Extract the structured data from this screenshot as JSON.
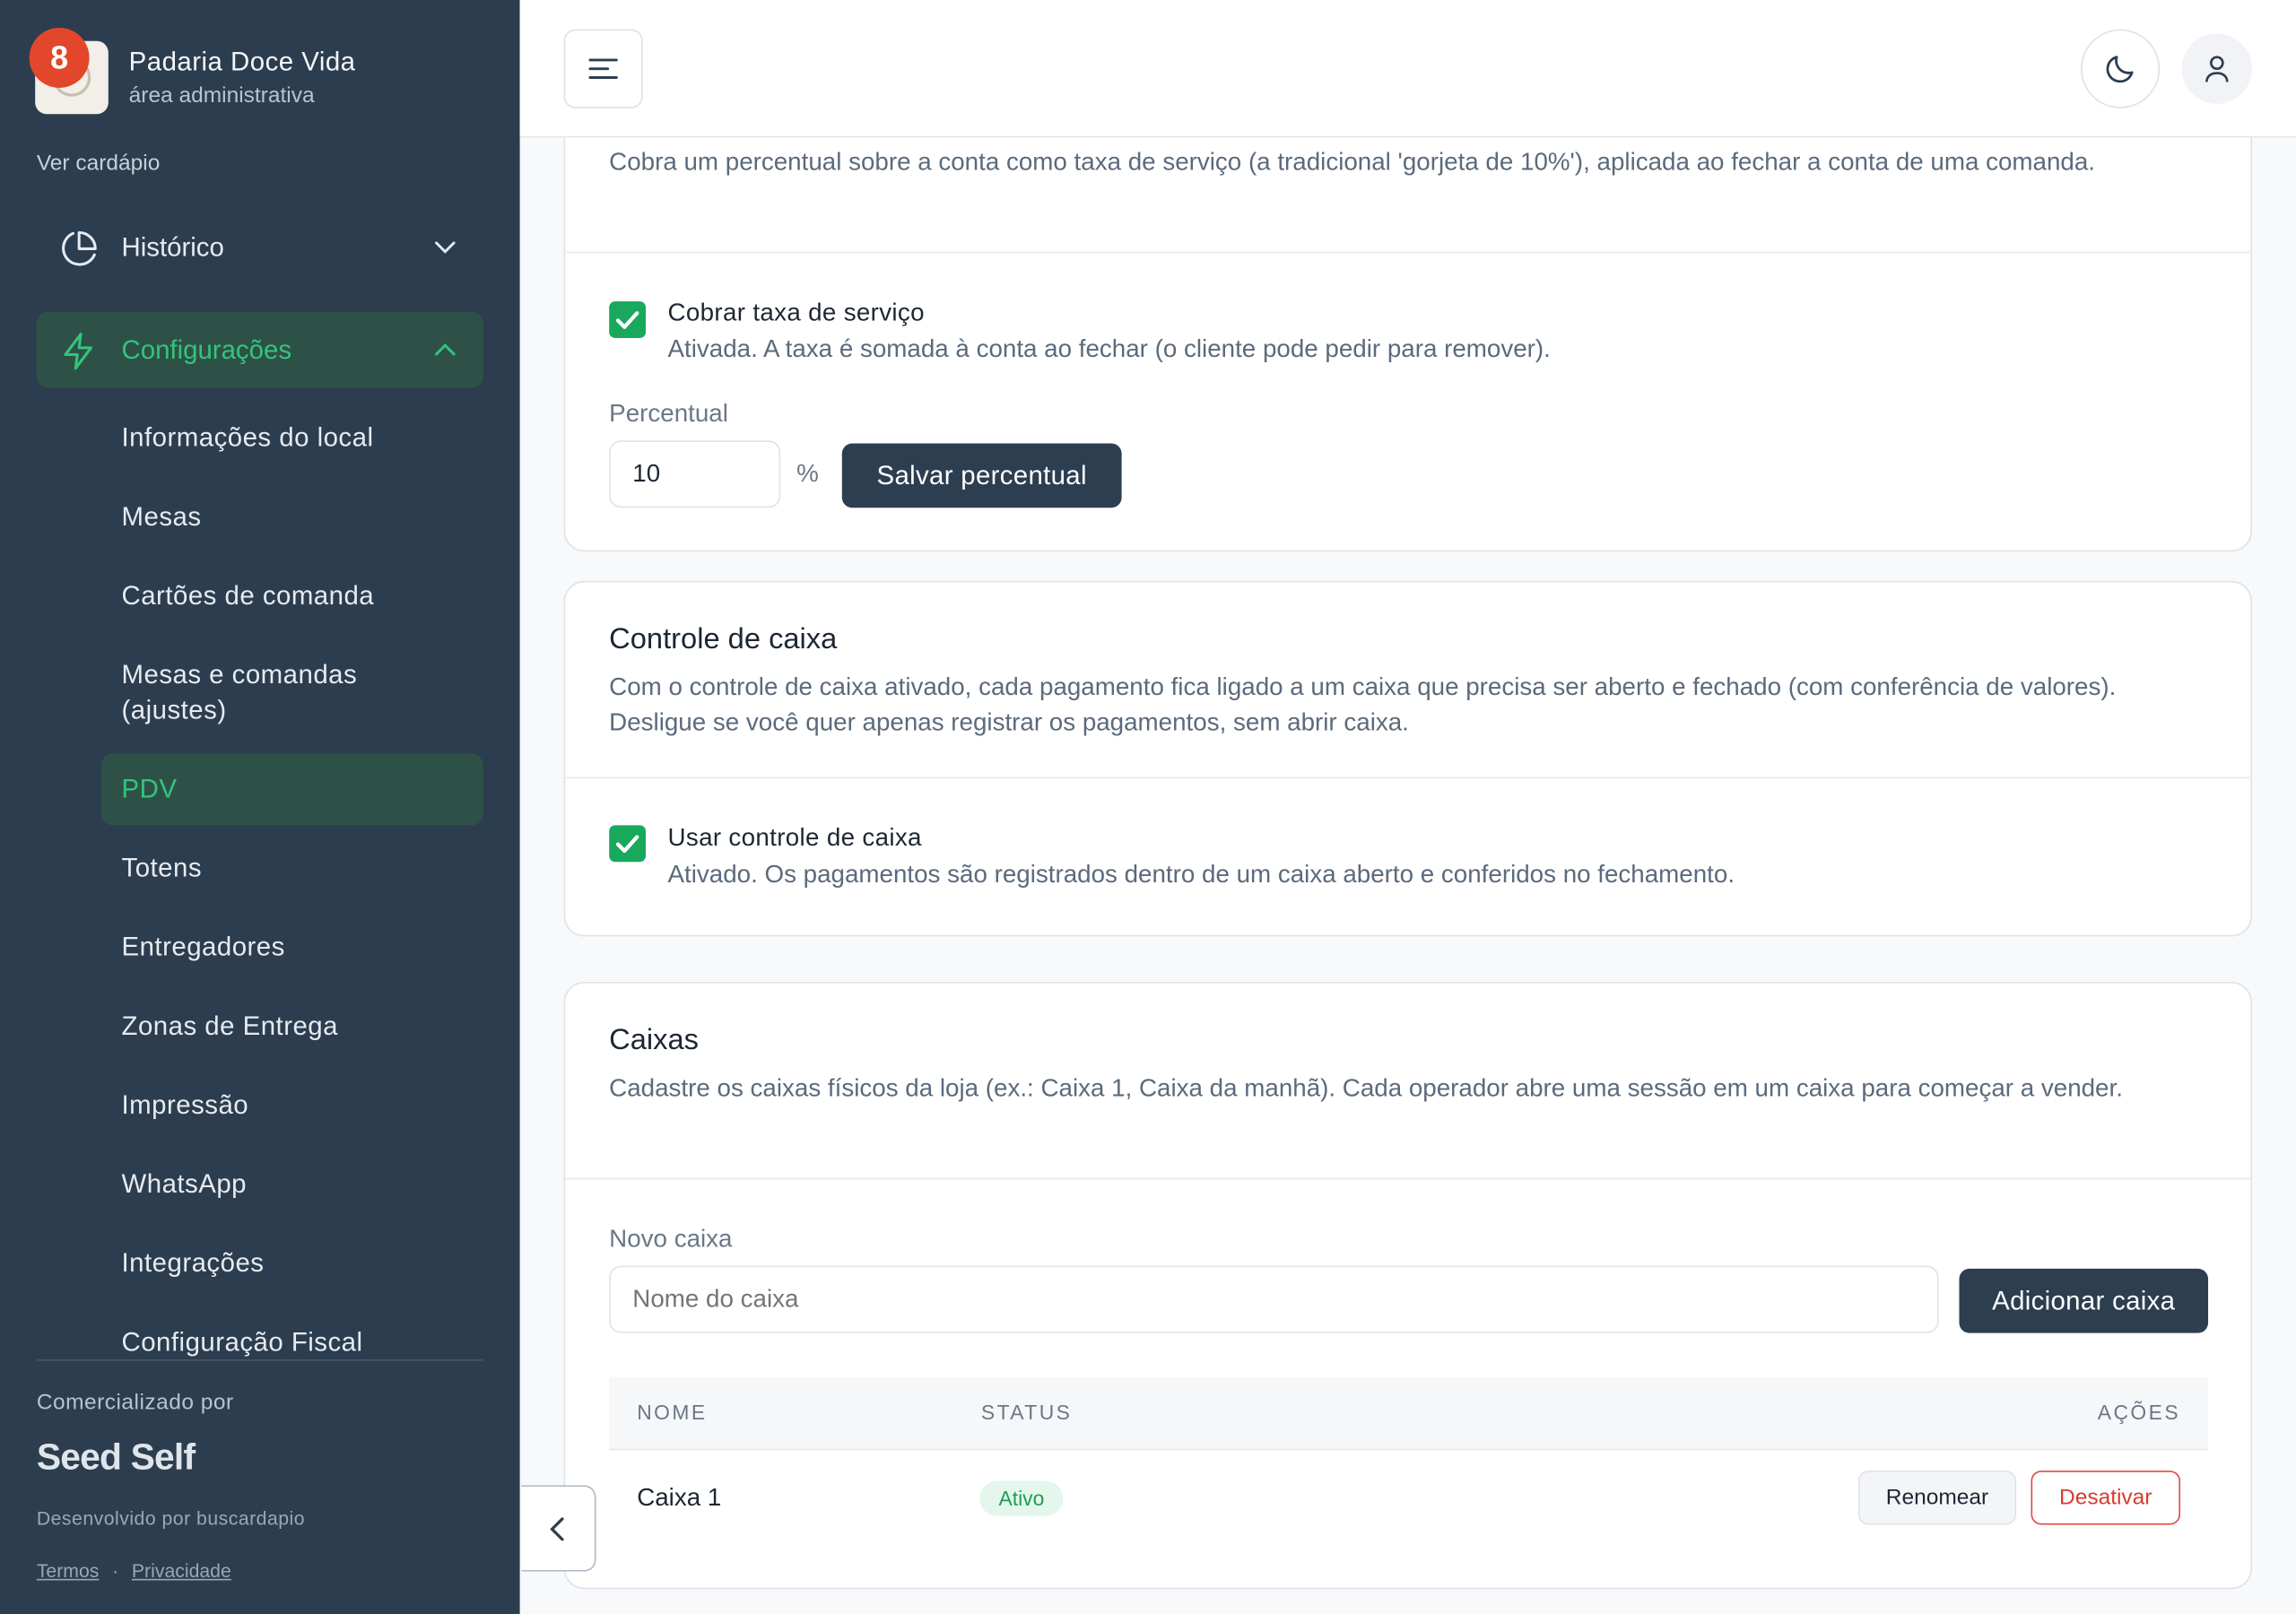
{
  "brand": {
    "name": "Padaria Doce Vida",
    "subtitle": "área administrativa",
    "notifications": "8"
  },
  "sidebar": {
    "menu_link": "Ver cardápio",
    "historico": "Histórico",
    "configuracoes": "Configurações",
    "items": [
      "Informações do local",
      "Mesas",
      "Cartões de comanda",
      "Mesas e comandas (ajustes)",
      "PDV",
      "Totens",
      "Entregadores",
      "Zonas de Entrega",
      "Impressão",
      "WhatsApp",
      "Integrações",
      "Configuração Fiscal"
    ],
    "active_item": "PDV",
    "commercialized_by": "Comercializado por",
    "company": "Seed Self",
    "developed_by": "Desenvolvido por buscardapio",
    "terms": "Termos",
    "privacy": "Privacidade",
    "separator": "·"
  },
  "service_fee": {
    "description": "Cobra um percentual sobre a conta como taxa de serviço (a tradicional 'gorjeta de 10%'), aplicada ao fechar a conta de uma comanda.",
    "checkbox_title": "Cobrar taxa de serviço",
    "checkbox_desc": "Ativada. A taxa é somada à conta ao fechar (o cliente pode pedir para remover).",
    "checked": true,
    "percent_label": "Percentual",
    "percent_value": "10",
    "percent_symbol": "%",
    "save_button": "Salvar percentual"
  },
  "cash_control": {
    "title": "Controle de caixa",
    "description": "Com o controle de caixa ativado, cada pagamento fica ligado a um caixa que precisa ser aberto e fechado (com conferência de valores). Desligue se você quer apenas registrar os pagamentos, sem abrir caixa.",
    "checkbox_title": "Usar controle de caixa",
    "checkbox_desc": "Ativado. Os pagamentos são registrados dentro de um caixa aberto e conferidos no fechamento.",
    "checked": true
  },
  "registers": {
    "title": "Caixas",
    "description": "Cadastre os caixas físicos da loja (ex.: Caixa 1, Caixa da manhã). Cada operador abre uma sessão em um caixa para começar a vender.",
    "new_label": "Novo caixa",
    "new_placeholder": "Nome do caixa",
    "add_button": "Adicionar caixa",
    "columns": {
      "name": "NOME",
      "status": "STATUS",
      "actions": "AÇÕES"
    },
    "rows": [
      {
        "name": "Caixa 1",
        "status": "Ativo",
        "rename": "Renomear",
        "deactivate": "Desativar"
      }
    ]
  },
  "colors": {
    "sidebar_bg": "#2c3d4f",
    "accent_green": "#34c47c",
    "checkbox_green": "#1aa85d",
    "dark_button": "#2d3e50",
    "danger": "#d73a2f",
    "notification": "#e2472b"
  },
  "icons": {
    "historico": "pie-chart-icon",
    "configuracoes": "bolt-icon",
    "menu": "menu-lines-icon",
    "theme": "moon-icon",
    "user": "user-icon",
    "collapse": "chevron-left-icon"
  }
}
